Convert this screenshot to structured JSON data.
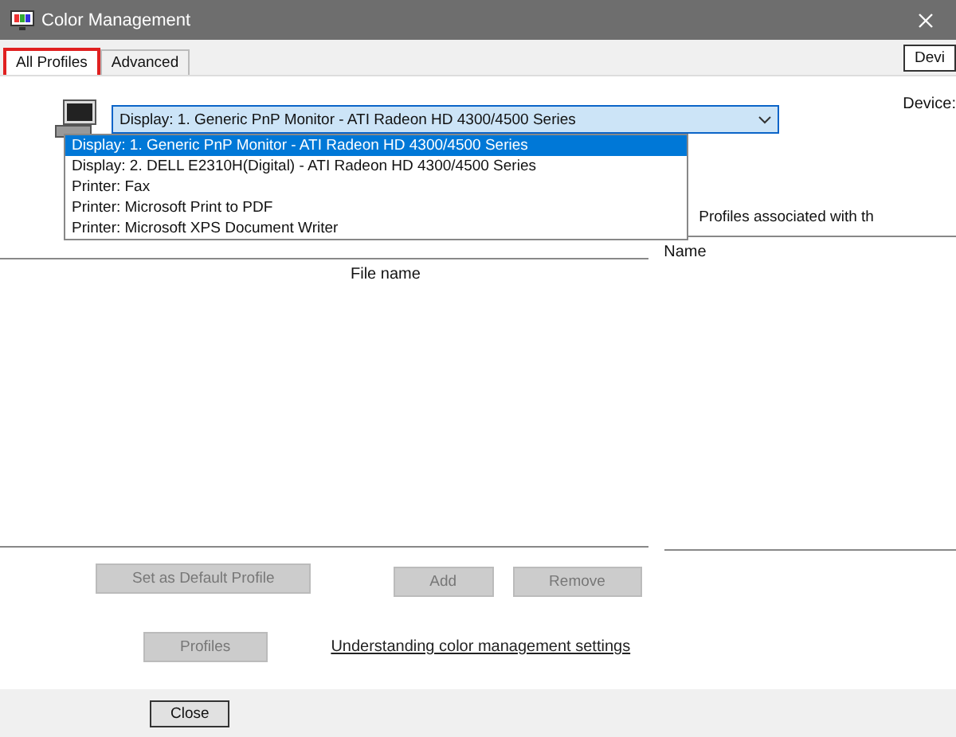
{
  "window": {
    "title": "Color Management"
  },
  "tabs": [
    {
      "label": "All Profiles",
      "selected": true
    },
    {
      "label": "Advanced",
      "selected": false
    }
  ],
  "corner_tab": {
    "label": "Devi"
  },
  "device_select": {
    "value": "Display: 1. Generic PnP Monitor - ATI Radeon HD 4300/4500 Series",
    "expanded": true,
    "options": [
      {
        "label": "Display: 1. Generic PnP Monitor - ATI Radeon HD 4300/4500 Series",
        "selected": true
      },
      {
        "label": "Display: 2. DELL E2310H(Digital) - ATI Radeon HD 4300/4500 Series",
        "selected": false
      },
      {
        "label": "Printer: Fax",
        "selected": false
      },
      {
        "label": "Printer: Microsoft Print to PDF",
        "selected": false
      },
      {
        "label": "Printer: Microsoft XPS Document Writer",
        "selected": false
      }
    ]
  },
  "right_panel": {
    "device_label": "Device:",
    "profiles_label": "Profiles associated with th",
    "column": "Name"
  },
  "file_list": {
    "column": "File name"
  },
  "buttons": [
    {
      "label": "Add",
      "disabled": true
    },
    {
      "label": "Remove",
      "disabled": true
    }
  ],
  "default_button": {
    "label": "Set as Default Profile",
    "disabled": true
  },
  "profiles_button": {
    "label": "Profiles",
    "disabled": true
  },
  "help_link": "Understanding color management settings",
  "close_button": {
    "label": "Close"
  }
}
